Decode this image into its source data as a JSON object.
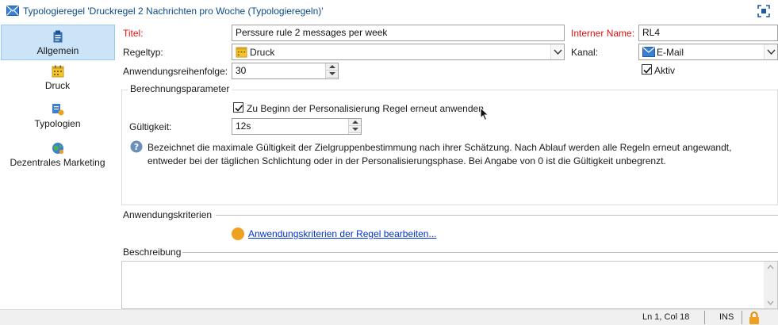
{
  "window": {
    "title": "Typologieregel 'Druckregel 2 Nachrichten pro Woche (Typologieregeln)'"
  },
  "sidebar": {
    "items": [
      {
        "label": "Allgemein",
        "icon": "clipboard-icon",
        "selected": true
      },
      {
        "label": "Druck",
        "icon": "print-calendar-icon",
        "selected": false
      },
      {
        "label": "Typologien",
        "icon": "typology-icon",
        "selected": false
      },
      {
        "label": "Dezentrales Marketing",
        "icon": "globe-icon",
        "selected": false
      }
    ]
  },
  "form": {
    "titel_label": "Titel:",
    "titel_value": "Perssure rule 2 messages per week",
    "internal_name_label": "Interner Name:",
    "internal_name_value": "RL4",
    "regeltyp_label": "Regeltyp:",
    "regeltyp_value": "Druck",
    "kanal_label": "Kanal:",
    "kanal_value": "E-Mail",
    "reihenfolge_label": "Anwendungsreihenfolge:",
    "reihenfolge_value": "30",
    "aktiv_label": "Aktiv",
    "aktiv_checked": true
  },
  "berechnung": {
    "group_title": "Berechnungsparameter",
    "reapply_label": "Zu Beginn der Personalisierung Regel erneut anwenden",
    "reapply_checked": true,
    "gueltigkeit_label": "Gültigkeit:",
    "gueltigkeit_value": "12s",
    "help_text": "Bezeichnet die maximale Gültigkeit der Zielgruppenbestimmung nach ihrer Schätzung. Nach Ablauf werden alle Regeln erneut angewandt, entweder bei der täglichen Schlichtung oder in der Personalisierungsphase. Bei Angabe von 0 ist die Gültigkeit unbegrenzt."
  },
  "kriterien": {
    "section_title": "Anwendungskriterien",
    "link_label": "Anwendungskriterien der Regel bearbeiten..."
  },
  "beschreibung": {
    "section_title": "Beschreibung",
    "value": ""
  },
  "statusbar": {
    "position": "Ln 1, Col 18",
    "mode": "INS"
  },
  "colors": {
    "accent_selected": "#cce4f7",
    "required_label": "#e01010",
    "link": "#0033cc",
    "criteria_dot": "#f0a020"
  }
}
